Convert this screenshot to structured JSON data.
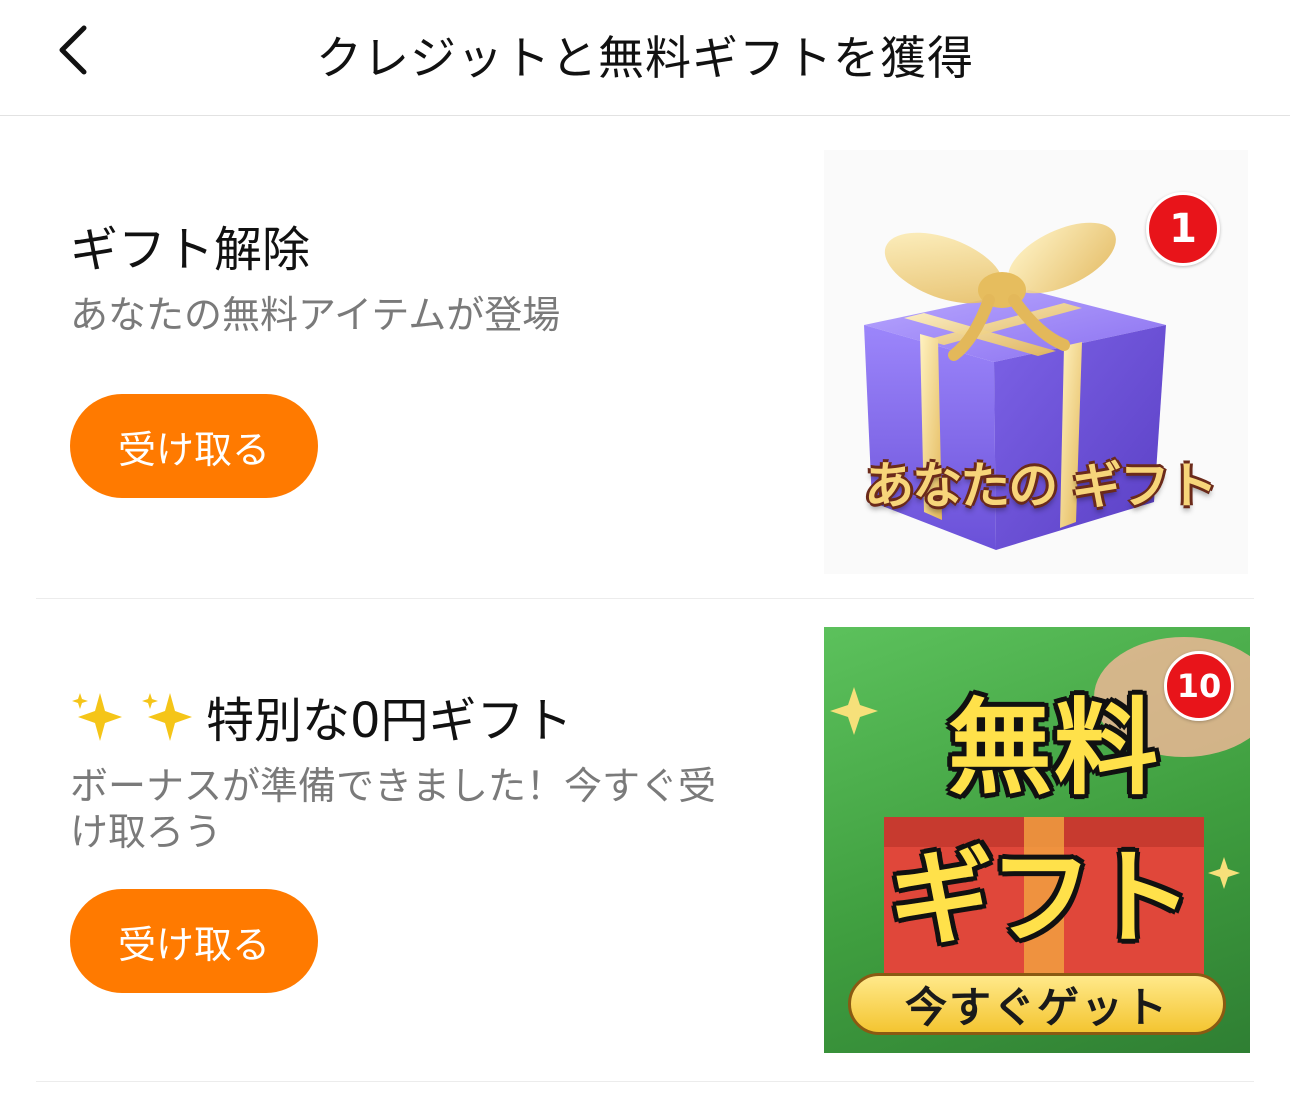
{
  "header": {
    "title": "クレジットと無料ギフトを獲得",
    "back_icon": "chevron-left-icon"
  },
  "cards": [
    {
      "title": "ギフト解除",
      "description": "あなたの無料アイテムが登場",
      "button_label": "受け取る",
      "image": {
        "overlay_text": "あなたの ギフト",
        "badge_count": "1"
      }
    },
    {
      "title_emoji": "✨✨",
      "title": "特別な0円ギフト",
      "description": "ボーナスが準備できました！今すぐ受け取ろう",
      "button_label": "受け取る",
      "image": {
        "line1": "無料",
        "line2": "ギフト",
        "cta": "今すぐゲット",
        "badge_count": "10"
      }
    }
  ],
  "colors": {
    "accent": "#ff7a00",
    "badge": "#e8141a",
    "gift_purple": "#8f79f2",
    "gift_ribbon": "#f0d27a",
    "banner_green": "#3f9e3f"
  }
}
